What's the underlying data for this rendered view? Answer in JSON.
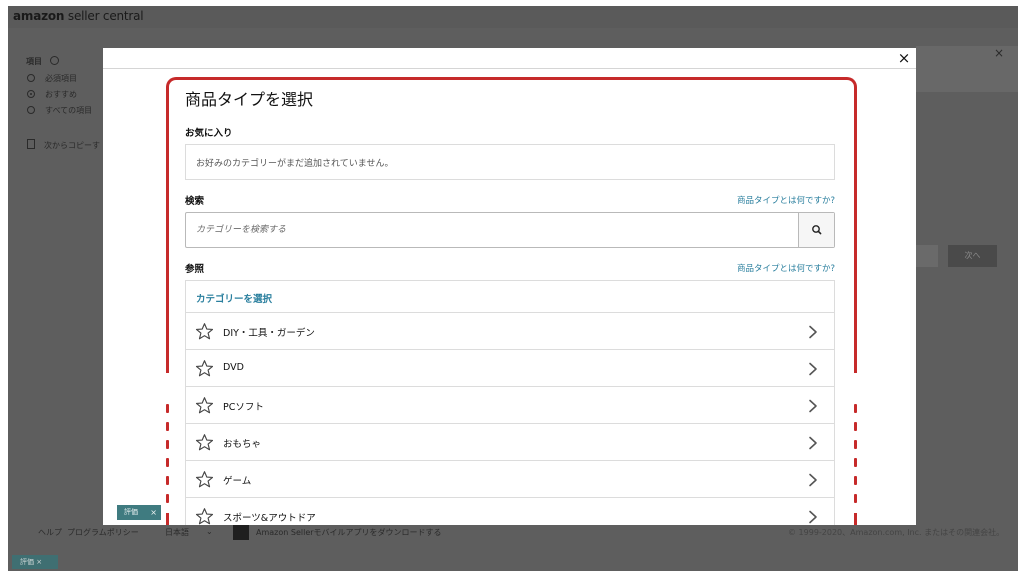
{
  "background": {
    "logo_brand": "amazon",
    "logo_rest": " seller central",
    "item_label": "項目",
    "radio_options": [
      "必須項目",
      "おすすめ",
      "すべての項目"
    ],
    "copy_from": "次からコピーす",
    "footer_links": [
      "ヘルプ",
      "プログラムポリシー",
      "日本語"
    ],
    "footer_app": "Amazon Sellerモバイルアプリをダウンロードする",
    "footer_copyright": "© 1999-2020、Amazon.com, Inc. またはその関連会社。",
    "footer_badge": "評価",
    "next_button": "次へ"
  },
  "modal": {
    "title": "商品タイプを選択",
    "favorites_label": "お気に入り",
    "favorites_empty": "お好みのカテゴリーがまだ追加されていません。",
    "search_label": "検索",
    "search_help": "商品タイプとは何ですか?",
    "search_placeholder": "カテゴリーを検索する",
    "browse_label": "参照",
    "browse_help": "商品タイプとは何ですか?",
    "browse_header": "カテゴリーを選択",
    "categories": [
      "DIY・工具・ガーデン",
      "DVD",
      "PCソフト",
      "おもちゃ",
      "ゲーム",
      "スポーツ&アウトドア"
    ],
    "badge": "評価",
    "badge_close": "×",
    "close": "×"
  },
  "colors": {
    "highlight": "#c62a2a",
    "link": "#2a7f9e",
    "badge": "#3f7b80"
  },
  "icons": {
    "close": "close-icon",
    "search": "search-icon",
    "star": "star-outline-icon",
    "chevron": "chevron-right-icon",
    "help": "help-circle-icon",
    "copy": "copy-icon",
    "phone": "mobile-phone-icon"
  }
}
